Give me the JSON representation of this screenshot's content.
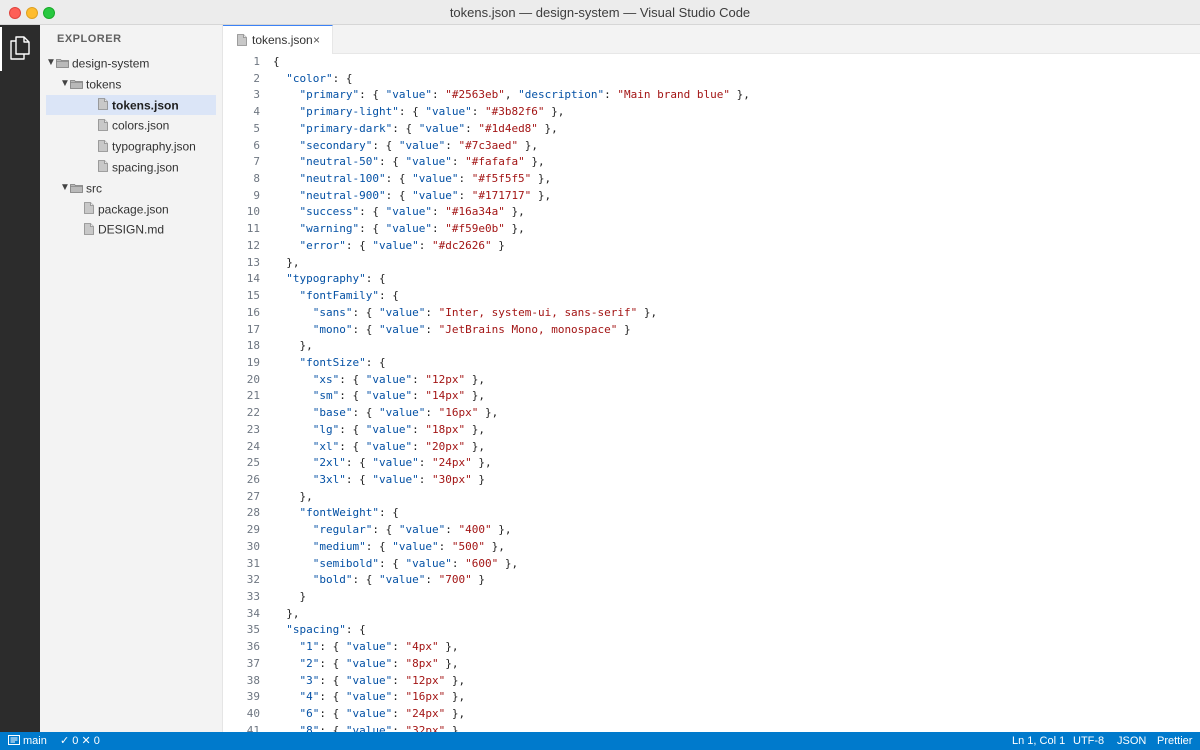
{
  "window": {
    "title": "tokens.json — design-system — Visual Studio Code"
  },
  "activity_bar": {
    "active_icon": "files-icon"
  },
  "sidebar": {
    "title": "EXPLORER",
    "tree": [
      {
        "label": "design-system",
        "type": "folder",
        "expanded": true,
        "depth": 0
      },
      {
        "label": "tokens",
        "type": "folder",
        "expanded": true,
        "depth": 1
      },
      {
        "label": "tokens.json",
        "type": "file",
        "depth": 2,
        "selected": true
      },
      {
        "label": "colors.json",
        "type": "file",
        "depth": 2
      },
      {
        "label": "typography.json",
        "type": "file",
        "depth": 2
      },
      {
        "label": "spacing.json",
        "type": "file",
        "depth": 2
      },
      {
        "label": "src",
        "type": "folder",
        "expanded": true,
        "depth": 1
      },
      {
        "label": "package.json",
        "type": "file",
        "depth": 1
      },
      {
        "label": "DESIGN.md",
        "type": "file",
        "depth": 1
      }
    ]
  },
  "tabs": [
    {
      "label": "tokens.json",
      "close": "×"
    }
  ],
  "editor": {
    "lines": [
      [
        [
          "p",
          "{"
        ]
      ],
      [
        [
          "p",
          "  "
        ],
        [
          "k",
          "\"color\""
        ],
        [
          "p",
          ": {"
        ]
      ],
      [
        [
          "p",
          "    "
        ],
        [
          "k",
          "\"primary\""
        ],
        [
          "p",
          ": { "
        ],
        [
          "k",
          "\"value\""
        ],
        [
          "p",
          ": "
        ],
        [
          "s",
          "\"#2563eb\""
        ],
        [
          "p",
          ", "
        ],
        [
          "k",
          "\"description\""
        ],
        [
          "p",
          ": "
        ],
        [
          "s",
          "\"Main brand blue\""
        ],
        [
          "p",
          " },"
        ]
      ],
      [
        [
          "p",
          "    "
        ],
        [
          "k",
          "\"primary-light\""
        ],
        [
          "p",
          ": { "
        ],
        [
          "k",
          "\"value\""
        ],
        [
          "p",
          ": "
        ],
        [
          "s",
          "\"#3b82f6\""
        ],
        [
          "p",
          " },"
        ]
      ],
      [
        [
          "p",
          "    "
        ],
        [
          "k",
          "\"primary-dark\""
        ],
        [
          "p",
          ": { "
        ],
        [
          "k",
          "\"value\""
        ],
        [
          "p",
          ": "
        ],
        [
          "s",
          "\"#1d4ed8\""
        ],
        [
          "p",
          " },"
        ]
      ],
      [
        [
          "p",
          "    "
        ],
        [
          "k",
          "\"secondary\""
        ],
        [
          "p",
          ": { "
        ],
        [
          "k",
          "\"value\""
        ],
        [
          "p",
          ": "
        ],
        [
          "s",
          "\"#7c3aed\""
        ],
        [
          "p",
          " },"
        ]
      ],
      [
        [
          "p",
          "    "
        ],
        [
          "k",
          "\"neutral-50\""
        ],
        [
          "p",
          ": { "
        ],
        [
          "k",
          "\"value\""
        ],
        [
          "p",
          ": "
        ],
        [
          "s",
          "\"#fafafa\""
        ],
        [
          "p",
          " },"
        ]
      ],
      [
        [
          "p",
          "    "
        ],
        [
          "k",
          "\"neutral-100\""
        ],
        [
          "p",
          ": { "
        ],
        [
          "k",
          "\"value\""
        ],
        [
          "p",
          ": "
        ],
        [
          "s",
          "\"#f5f5f5\""
        ],
        [
          "p",
          " },"
        ]
      ],
      [
        [
          "p",
          "    "
        ],
        [
          "k",
          "\"neutral-900\""
        ],
        [
          "p",
          ": { "
        ],
        [
          "k",
          "\"value\""
        ],
        [
          "p",
          ": "
        ],
        [
          "s",
          "\"#171717\""
        ],
        [
          "p",
          " },"
        ]
      ],
      [
        [
          "p",
          "    "
        ],
        [
          "k",
          "\"success\""
        ],
        [
          "p",
          ": { "
        ],
        [
          "k",
          "\"value\""
        ],
        [
          "p",
          ": "
        ],
        [
          "s",
          "\"#16a34a\""
        ],
        [
          "p",
          " },"
        ]
      ],
      [
        [
          "p",
          "    "
        ],
        [
          "k",
          "\"warning\""
        ],
        [
          "p",
          ": { "
        ],
        [
          "k",
          "\"value\""
        ],
        [
          "p",
          ": "
        ],
        [
          "s",
          "\"#f59e0b\""
        ],
        [
          "p",
          " },"
        ]
      ],
      [
        [
          "p",
          "    "
        ],
        [
          "k",
          "\"error\""
        ],
        [
          "p",
          ": { "
        ],
        [
          "k",
          "\"value\""
        ],
        [
          "p",
          ": "
        ],
        [
          "s",
          "\"#dc2626\""
        ],
        [
          "p",
          " }"
        ]
      ],
      [
        [
          "p",
          "  },"
        ]
      ],
      [
        [
          "p",
          "  "
        ],
        [
          "k",
          "\"typography\""
        ],
        [
          "p",
          ": {"
        ]
      ],
      [
        [
          "p",
          "    "
        ],
        [
          "k",
          "\"fontFamily\""
        ],
        [
          "p",
          ": {"
        ]
      ],
      [
        [
          "p",
          "      "
        ],
        [
          "k",
          "\"sans\""
        ],
        [
          "p",
          ": { "
        ],
        [
          "k",
          "\"value\""
        ],
        [
          "p",
          ": "
        ],
        [
          "s",
          "\"Inter, system-ui, sans-serif\""
        ],
        [
          "p",
          " },"
        ]
      ],
      [
        [
          "p",
          "      "
        ],
        [
          "k",
          "\"mono\""
        ],
        [
          "p",
          ": { "
        ],
        [
          "k",
          "\"value\""
        ],
        [
          "p",
          ": "
        ],
        [
          "s",
          "\"JetBrains Mono, monospace\""
        ],
        [
          "p",
          " }"
        ]
      ],
      [
        [
          "p",
          "    },"
        ]
      ],
      [
        [
          "p",
          "    "
        ],
        [
          "k",
          "\"fontSize\""
        ],
        [
          "p",
          ": {"
        ]
      ],
      [
        [
          "p",
          "      "
        ],
        [
          "k",
          "\"xs\""
        ],
        [
          "p",
          ": { "
        ],
        [
          "k",
          "\"value\""
        ],
        [
          "p",
          ": "
        ],
        [
          "s",
          "\"12px\""
        ],
        [
          "p",
          " },"
        ]
      ],
      [
        [
          "p",
          "      "
        ],
        [
          "k",
          "\"sm\""
        ],
        [
          "p",
          ": { "
        ],
        [
          "k",
          "\"value\""
        ],
        [
          "p",
          ": "
        ],
        [
          "s",
          "\"14px\""
        ],
        [
          "p",
          " },"
        ]
      ],
      [
        [
          "p",
          "      "
        ],
        [
          "k",
          "\"base\""
        ],
        [
          "p",
          ": { "
        ],
        [
          "k",
          "\"value\""
        ],
        [
          "p",
          ": "
        ],
        [
          "s",
          "\"16px\""
        ],
        [
          "p",
          " },"
        ]
      ],
      [
        [
          "p",
          "      "
        ],
        [
          "k",
          "\"lg\""
        ],
        [
          "p",
          ": { "
        ],
        [
          "k",
          "\"value\""
        ],
        [
          "p",
          ": "
        ],
        [
          "s",
          "\"18px\""
        ],
        [
          "p",
          " },"
        ]
      ],
      [
        [
          "p",
          "      "
        ],
        [
          "k",
          "\"xl\""
        ],
        [
          "p",
          ": { "
        ],
        [
          "k",
          "\"value\""
        ],
        [
          "p",
          ": "
        ],
        [
          "s",
          "\"20px\""
        ],
        [
          "p",
          " },"
        ]
      ],
      [
        [
          "p",
          "      "
        ],
        [
          "k",
          "\"2xl\""
        ],
        [
          "p",
          ": { "
        ],
        [
          "k",
          "\"value\""
        ],
        [
          "p",
          ": "
        ],
        [
          "s",
          "\"24px\""
        ],
        [
          "p",
          " },"
        ]
      ],
      [
        [
          "p",
          "      "
        ],
        [
          "k",
          "\"3xl\""
        ],
        [
          "p",
          ": { "
        ],
        [
          "k",
          "\"value\""
        ],
        [
          "p",
          ": "
        ],
        [
          "s",
          "\"30px\""
        ],
        [
          "p",
          " }"
        ]
      ],
      [
        [
          "p",
          "    },"
        ]
      ],
      [
        [
          "p",
          "    "
        ],
        [
          "k",
          "\"fontWeight\""
        ],
        [
          "p",
          ": {"
        ]
      ],
      [
        [
          "p",
          "      "
        ],
        [
          "k",
          "\"regular\""
        ],
        [
          "p",
          ": { "
        ],
        [
          "k",
          "\"value\""
        ],
        [
          "p",
          ": "
        ],
        [
          "s",
          "\"400\""
        ],
        [
          "p",
          " },"
        ]
      ],
      [
        [
          "p",
          "      "
        ],
        [
          "k",
          "\"medium\""
        ],
        [
          "p",
          ": { "
        ],
        [
          "k",
          "\"value\""
        ],
        [
          "p",
          ": "
        ],
        [
          "s",
          "\"500\""
        ],
        [
          "p",
          " },"
        ]
      ],
      [
        [
          "p",
          "      "
        ],
        [
          "k",
          "\"semibold\""
        ],
        [
          "p",
          ": { "
        ],
        [
          "k",
          "\"value\""
        ],
        [
          "p",
          ": "
        ],
        [
          "s",
          "\"600\""
        ],
        [
          "p",
          " },"
        ]
      ],
      [
        [
          "p",
          "      "
        ],
        [
          "k",
          "\"bold\""
        ],
        [
          "p",
          ": { "
        ],
        [
          "k",
          "\"value\""
        ],
        [
          "p",
          ": "
        ],
        [
          "s",
          "\"700\""
        ],
        [
          "p",
          " }"
        ]
      ],
      [
        [
          "p",
          "    }"
        ]
      ],
      [
        [
          "p",
          "  },"
        ]
      ],
      [
        [
          "p",
          "  "
        ],
        [
          "k",
          "\"spacing\""
        ],
        [
          "p",
          ": {"
        ]
      ],
      [
        [
          "p",
          "    "
        ],
        [
          "k",
          "\"1\""
        ],
        [
          "p",
          ": { "
        ],
        [
          "k",
          "\"value\""
        ],
        [
          "p",
          ": "
        ],
        [
          "s",
          "\"4px\""
        ],
        [
          "p",
          " },"
        ]
      ],
      [
        [
          "p",
          "    "
        ],
        [
          "k",
          "\"2\""
        ],
        [
          "p",
          ": { "
        ],
        [
          "k",
          "\"value\""
        ],
        [
          "p",
          ": "
        ],
        [
          "s",
          "\"8px\""
        ],
        [
          "p",
          " },"
        ]
      ],
      [
        [
          "p",
          "    "
        ],
        [
          "k",
          "\"3\""
        ],
        [
          "p",
          ": { "
        ],
        [
          "k",
          "\"value\""
        ],
        [
          "p",
          ": "
        ],
        [
          "s",
          "\"12px\""
        ],
        [
          "p",
          " },"
        ]
      ],
      [
        [
          "p",
          "    "
        ],
        [
          "k",
          "\"4\""
        ],
        [
          "p",
          ": { "
        ],
        [
          "k",
          "\"value\""
        ],
        [
          "p",
          ": "
        ],
        [
          "s",
          "\"16px\""
        ],
        [
          "p",
          " },"
        ]
      ],
      [
        [
          "p",
          "    "
        ],
        [
          "k",
          "\"6\""
        ],
        [
          "p",
          ": { "
        ],
        [
          "k",
          "\"value\""
        ],
        [
          "p",
          ": "
        ],
        [
          "s",
          "\"24px\""
        ],
        [
          "p",
          " },"
        ]
      ],
      [
        [
          "p",
          "    "
        ],
        [
          "k",
          "\"8\""
        ],
        [
          "p",
          ": { "
        ],
        [
          "k",
          "\"value\""
        ],
        [
          "p",
          ": "
        ],
        [
          "s",
          "\"32px\""
        ],
        [
          "p",
          " },"
        ]
      ]
    ]
  },
  "status_bar": {
    "branch": "main",
    "problems": "✓ 0 ✕ 0",
    "cursor": "Ln 1, Col 1",
    "encoding": "UTF-8",
    "language": "JSON",
    "formatter": "Prettier"
  },
  "colors": {
    "status_bar": "#007acc",
    "tab_accent": "#3b82f6",
    "selection": "#dbe5f7",
    "json_key": "#0451a5",
    "json_string": "#a31515"
  }
}
